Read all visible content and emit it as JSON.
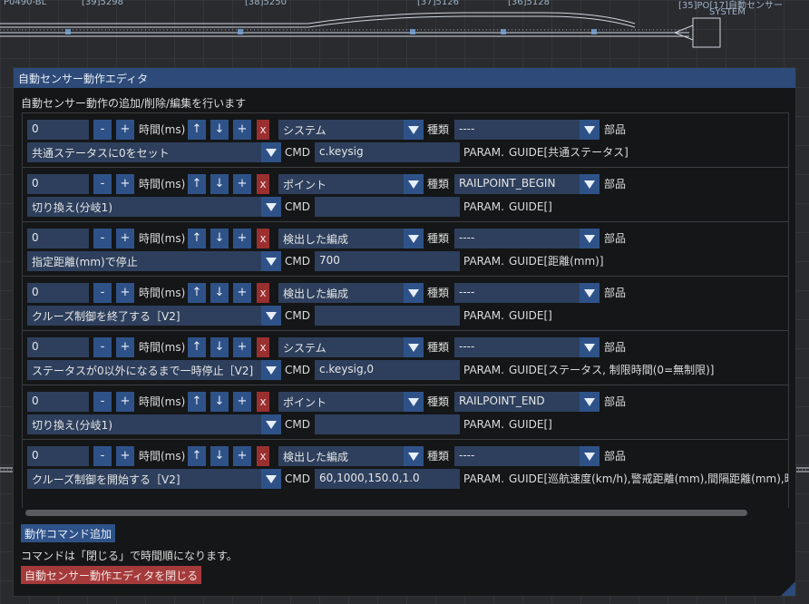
{
  "background": {
    "labels": [
      "P0490-BL",
      "[39]5298",
      "[38]5250",
      "[37]5126",
      "[36]5128",
      "[35]PO[17]自動センサー",
      "SYSTEM"
    ]
  },
  "window": {
    "title": "自動センサー動作エディタ",
    "description": "自動センサー動作の追加/削除/編集を行います"
  },
  "labels": {
    "time": "時間(ms)",
    "kind": "種類",
    "part": "部品",
    "cmd": "CMD",
    "param": "PARAM.",
    "minus": "-",
    "plus": "+",
    "up": "↑",
    "down": "↓",
    "add": "+",
    "delete": "x"
  },
  "entries": [
    {
      "time": "0",
      "category": "システム",
      "part": "----",
      "action": "共通ステータスに0をセット",
      "cmd": "c.keysig",
      "guide": "GUIDE[共通ステータス]"
    },
    {
      "time": "0",
      "category": "ポイント",
      "part": "RAILPOINT_BEGIN",
      "action": "切り換え(分岐1)",
      "cmd": "",
      "guide": "GUIDE[]"
    },
    {
      "time": "0",
      "category": "検出した編成",
      "part": "----",
      "action": "指定距離(mm)で停止",
      "cmd": "700",
      "guide": "GUIDE[距離(mm)]"
    },
    {
      "time": "0",
      "category": "検出した編成",
      "part": "----",
      "action": "クルーズ制御を終了する［V2]",
      "cmd": "",
      "guide": "GUIDE[]"
    },
    {
      "time": "0",
      "category": "システム",
      "part": "----",
      "action": "ステータスが0以外になるまで一時停止［V2]",
      "cmd": "c.keysig,0",
      "guide": "GUIDE[ステータス, 制限時間(0=無制限)]"
    },
    {
      "time": "0",
      "category": "ポイント",
      "part": "RAILPOINT_END",
      "action": "切り換え(分岐1)",
      "cmd": "",
      "guide": "GUIDE[]"
    },
    {
      "time": "0",
      "category": "検出した編成",
      "part": "----",
      "action": "クルーズ制御を開始する［V2]",
      "cmd": "60,1000,150.0,1.0",
      "guide": "GUIDE[巡航速度(km/h),警戒距離(mm),間隔距離(mm),時間"
    }
  ],
  "footer": {
    "add_button": "動作コマンド追加",
    "note": "コマンドは「閉じる」で時間順になります。",
    "close_button": "自動センサー動作エディタを閉じる"
  },
  "colors": {
    "accent": "#2e5288",
    "field": "#2d3f5c",
    "danger": "#9a2f30",
    "titlebar": "#2d4a78"
  }
}
